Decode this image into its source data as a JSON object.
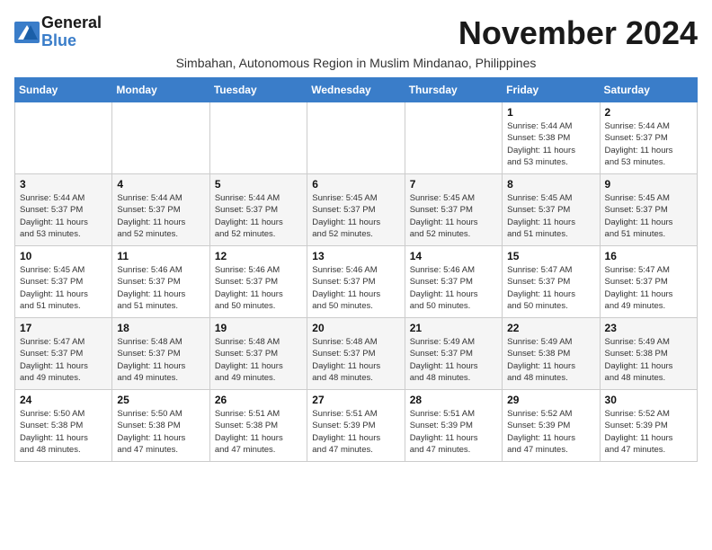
{
  "logo": {
    "line1": "General",
    "line2": "Blue"
  },
  "header": {
    "month_year": "November 2024",
    "subtitle": "Simbahan, Autonomous Region in Muslim Mindanao, Philippines"
  },
  "days_of_week": [
    "Sunday",
    "Monday",
    "Tuesday",
    "Wednesday",
    "Thursday",
    "Friday",
    "Saturday"
  ],
  "weeks": [
    [
      {
        "day": "",
        "info": ""
      },
      {
        "day": "",
        "info": ""
      },
      {
        "day": "",
        "info": ""
      },
      {
        "day": "",
        "info": ""
      },
      {
        "day": "",
        "info": ""
      },
      {
        "day": "1",
        "info": "Sunrise: 5:44 AM\nSunset: 5:38 PM\nDaylight: 11 hours\nand 53 minutes."
      },
      {
        "day": "2",
        "info": "Sunrise: 5:44 AM\nSunset: 5:37 PM\nDaylight: 11 hours\nand 53 minutes."
      }
    ],
    [
      {
        "day": "3",
        "info": "Sunrise: 5:44 AM\nSunset: 5:37 PM\nDaylight: 11 hours\nand 53 minutes."
      },
      {
        "day": "4",
        "info": "Sunrise: 5:44 AM\nSunset: 5:37 PM\nDaylight: 11 hours\nand 52 minutes."
      },
      {
        "day": "5",
        "info": "Sunrise: 5:44 AM\nSunset: 5:37 PM\nDaylight: 11 hours\nand 52 minutes."
      },
      {
        "day": "6",
        "info": "Sunrise: 5:45 AM\nSunset: 5:37 PM\nDaylight: 11 hours\nand 52 minutes."
      },
      {
        "day": "7",
        "info": "Sunrise: 5:45 AM\nSunset: 5:37 PM\nDaylight: 11 hours\nand 52 minutes."
      },
      {
        "day": "8",
        "info": "Sunrise: 5:45 AM\nSunset: 5:37 PM\nDaylight: 11 hours\nand 51 minutes."
      },
      {
        "day": "9",
        "info": "Sunrise: 5:45 AM\nSunset: 5:37 PM\nDaylight: 11 hours\nand 51 minutes."
      }
    ],
    [
      {
        "day": "10",
        "info": "Sunrise: 5:45 AM\nSunset: 5:37 PM\nDaylight: 11 hours\nand 51 minutes."
      },
      {
        "day": "11",
        "info": "Sunrise: 5:46 AM\nSunset: 5:37 PM\nDaylight: 11 hours\nand 51 minutes."
      },
      {
        "day": "12",
        "info": "Sunrise: 5:46 AM\nSunset: 5:37 PM\nDaylight: 11 hours\nand 50 minutes."
      },
      {
        "day": "13",
        "info": "Sunrise: 5:46 AM\nSunset: 5:37 PM\nDaylight: 11 hours\nand 50 minutes."
      },
      {
        "day": "14",
        "info": "Sunrise: 5:46 AM\nSunset: 5:37 PM\nDaylight: 11 hours\nand 50 minutes."
      },
      {
        "day": "15",
        "info": "Sunrise: 5:47 AM\nSunset: 5:37 PM\nDaylight: 11 hours\nand 50 minutes."
      },
      {
        "day": "16",
        "info": "Sunrise: 5:47 AM\nSunset: 5:37 PM\nDaylight: 11 hours\nand 49 minutes."
      }
    ],
    [
      {
        "day": "17",
        "info": "Sunrise: 5:47 AM\nSunset: 5:37 PM\nDaylight: 11 hours\nand 49 minutes."
      },
      {
        "day": "18",
        "info": "Sunrise: 5:48 AM\nSunset: 5:37 PM\nDaylight: 11 hours\nand 49 minutes."
      },
      {
        "day": "19",
        "info": "Sunrise: 5:48 AM\nSunset: 5:37 PM\nDaylight: 11 hours\nand 49 minutes."
      },
      {
        "day": "20",
        "info": "Sunrise: 5:48 AM\nSunset: 5:37 PM\nDaylight: 11 hours\nand 48 minutes."
      },
      {
        "day": "21",
        "info": "Sunrise: 5:49 AM\nSunset: 5:37 PM\nDaylight: 11 hours\nand 48 minutes."
      },
      {
        "day": "22",
        "info": "Sunrise: 5:49 AM\nSunset: 5:38 PM\nDaylight: 11 hours\nand 48 minutes."
      },
      {
        "day": "23",
        "info": "Sunrise: 5:49 AM\nSunset: 5:38 PM\nDaylight: 11 hours\nand 48 minutes."
      }
    ],
    [
      {
        "day": "24",
        "info": "Sunrise: 5:50 AM\nSunset: 5:38 PM\nDaylight: 11 hours\nand 48 minutes."
      },
      {
        "day": "25",
        "info": "Sunrise: 5:50 AM\nSunset: 5:38 PM\nDaylight: 11 hours\nand 47 minutes."
      },
      {
        "day": "26",
        "info": "Sunrise: 5:51 AM\nSunset: 5:38 PM\nDaylight: 11 hours\nand 47 minutes."
      },
      {
        "day": "27",
        "info": "Sunrise: 5:51 AM\nSunset: 5:39 PM\nDaylight: 11 hours\nand 47 minutes."
      },
      {
        "day": "28",
        "info": "Sunrise: 5:51 AM\nSunset: 5:39 PM\nDaylight: 11 hours\nand 47 minutes."
      },
      {
        "day": "29",
        "info": "Sunrise: 5:52 AM\nSunset: 5:39 PM\nDaylight: 11 hours\nand 47 minutes."
      },
      {
        "day": "30",
        "info": "Sunrise: 5:52 AM\nSunset: 5:39 PM\nDaylight: 11 hours\nand 47 minutes."
      }
    ]
  ]
}
